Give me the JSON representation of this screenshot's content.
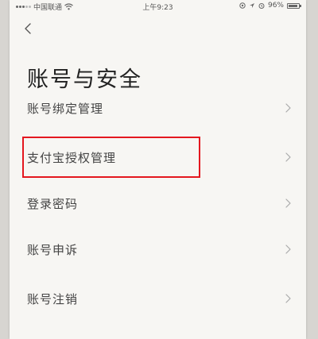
{
  "status_bar": {
    "carrier": "中国联通",
    "time": "上午9:23",
    "battery": "96%"
  },
  "header": {
    "title": "账号与安全"
  },
  "menu": {
    "items": [
      {
        "label": "账号绑定管理"
      },
      {
        "label": "支付宝授权管理"
      },
      {
        "label": "登录密码"
      },
      {
        "label": "账号申诉"
      },
      {
        "label": "账号注销"
      }
    ]
  },
  "colors": {
    "highlight": "#e4171f",
    "background": "#f7f6f3"
  },
  "icons": {
    "back": "chevron-left-icon",
    "item_arrow": "chevron-right-icon",
    "wifi": "wifi-icon",
    "battery": "battery-icon"
  }
}
